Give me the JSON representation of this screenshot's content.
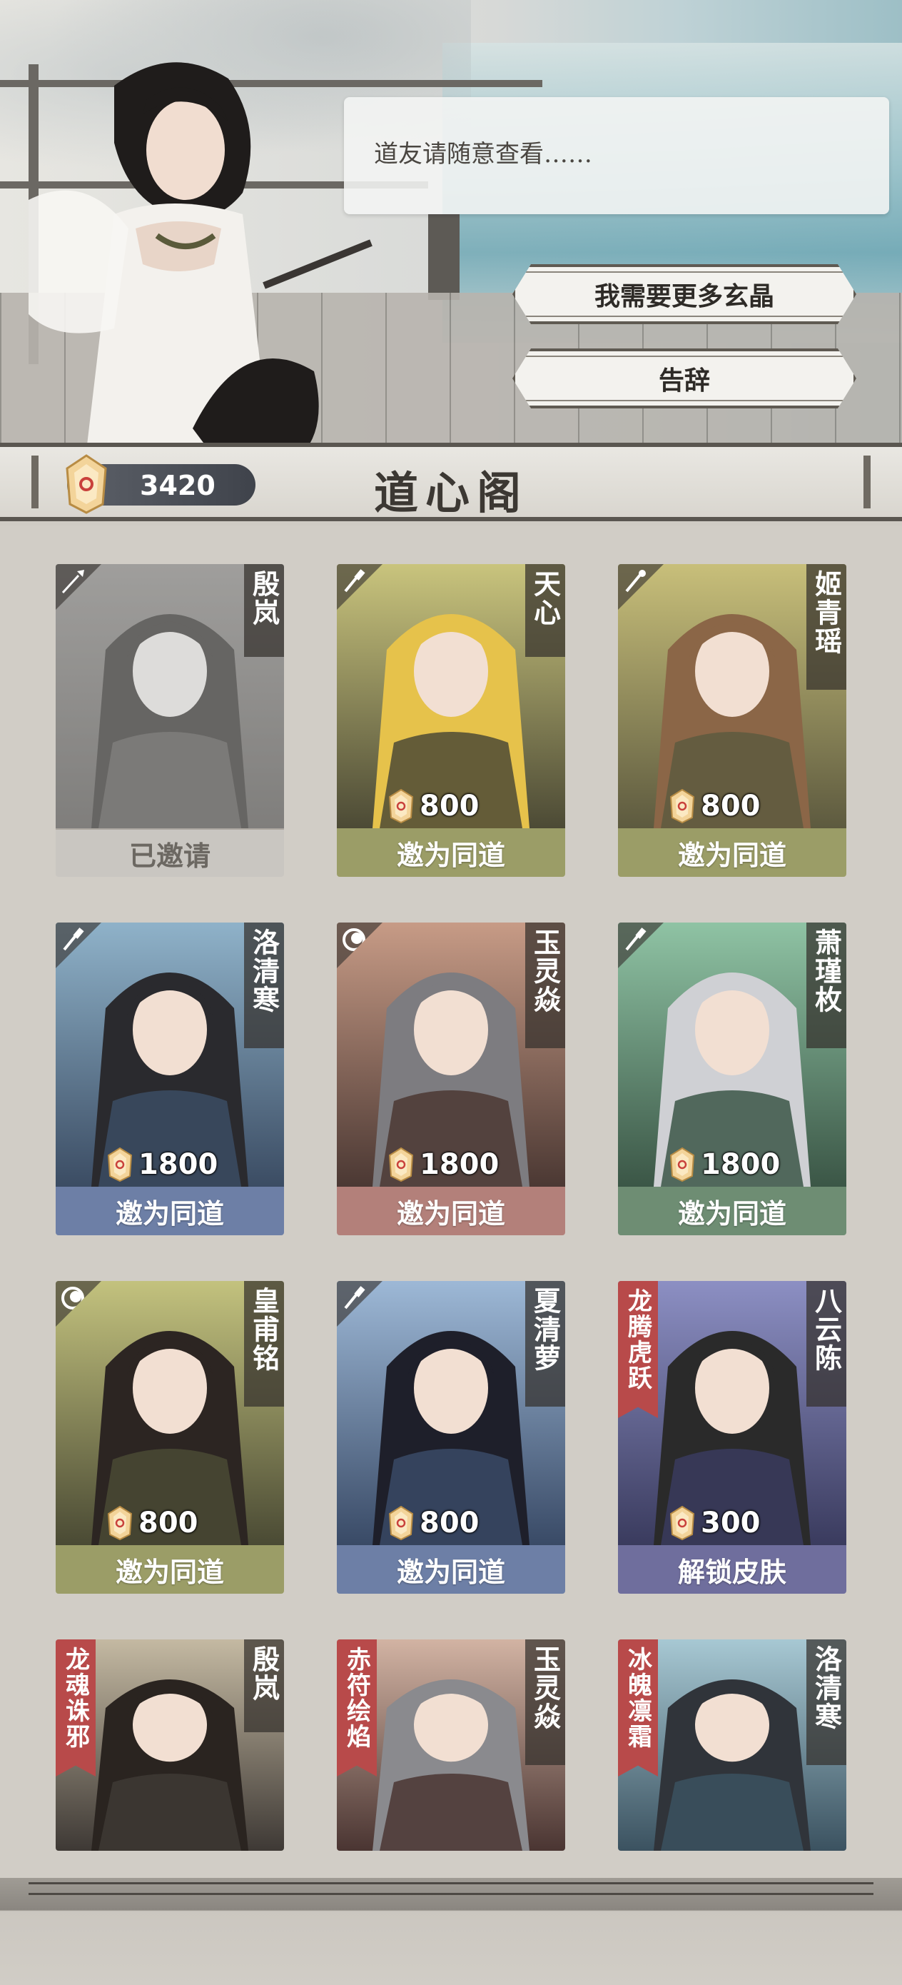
{
  "npc": {
    "dialog": "道友请随意查看……",
    "options": [
      "我需要更多玄晶",
      "告辞"
    ]
  },
  "header": {
    "currency_value": "3420",
    "title": "道心阁"
  },
  "colors": {
    "olive": "#9b9d67",
    "blue": "#6d7fa6",
    "rose": "#b3807a",
    "green": "#6e8d73",
    "purple": "#6f6e9d",
    "grey": "#c9c6c1"
  },
  "cards": [
    {
      "name": "殷岚",
      "tag": "",
      "price": "",
      "action": "已邀请",
      "state": "invited",
      "icon": "spear-icon"
    },
    {
      "name": "天心",
      "tag": "",
      "price": "800",
      "action": "邀为同道",
      "state": "olive",
      "icon": "sword-icon"
    },
    {
      "name": "姬青瑶",
      "tag": "",
      "price": "800",
      "action": "邀为同道",
      "state": "olive",
      "icon": "staff-icon"
    },
    {
      "name": "洛清寒",
      "tag": "",
      "price": "1800",
      "action": "邀为同道",
      "state": "blue",
      "icon": "sword-icon"
    },
    {
      "name": "玉灵焱",
      "tag": "",
      "price": "1800",
      "action": "邀为同道",
      "state": "rose",
      "icon": "moon-icon"
    },
    {
      "name": "萧瑾枚",
      "tag": "",
      "price": "1800",
      "action": "邀为同道",
      "state": "green",
      "icon": "sword-icon"
    },
    {
      "name": "皇甫铭",
      "tag": "",
      "price": "800",
      "action": "邀为同道",
      "state": "olive",
      "icon": "moon-icon"
    },
    {
      "name": "夏清萝",
      "tag": "",
      "price": "800",
      "action": "邀为同道",
      "state": "blue",
      "icon": "sword-icon"
    },
    {
      "name": "八云陈",
      "tag": "龙腾虎跃",
      "price": "300",
      "action": "解锁皮肤",
      "state": "purple",
      "icon": ""
    },
    {
      "name": "殷岚",
      "tag": "龙魂诛邪",
      "price": "",
      "action": "",
      "state": "partial",
      "icon": ""
    },
    {
      "name": "玉灵焱",
      "tag": "赤符绘焰",
      "price": "",
      "action": "",
      "state": "partial",
      "icon": ""
    },
    {
      "name": "洛清寒",
      "tag": "冰魄凛霜",
      "price": "",
      "action": "",
      "state": "partial",
      "icon": ""
    }
  ]
}
